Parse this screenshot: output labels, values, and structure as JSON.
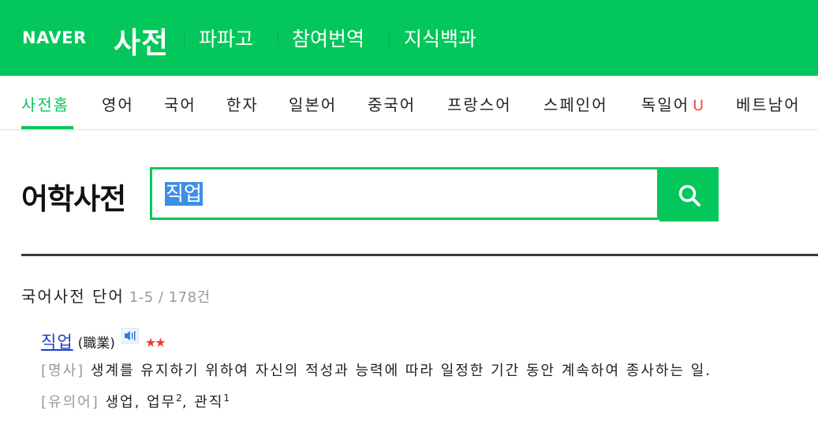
{
  "header": {
    "logo": "NAVER",
    "service": "사전",
    "links": [
      "파파고",
      "참여번역",
      "지식백과"
    ]
  },
  "tabs": [
    {
      "label": "사전홈",
      "active": true
    },
    {
      "label": "영어"
    },
    {
      "label": "국어"
    },
    {
      "label": "한자"
    },
    {
      "label": "일본어"
    },
    {
      "label": "중국어"
    },
    {
      "label": "프랑스어"
    },
    {
      "label": "스페인어"
    },
    {
      "label": "독일어",
      "badge": "U"
    },
    {
      "label": "베트남어"
    }
  ],
  "search": {
    "title": "어학사전",
    "value": "직업",
    "button_icon": "search-icon"
  },
  "results": {
    "section_title": "국어사전 단어",
    "count": "1-5 / 178건",
    "entries": [
      {
        "word": "직업",
        "hanja": "(職業)",
        "stars": "★★",
        "definition_tag": "[명사]",
        "definition": "생계를 유지하기 위하여 자신의 적성과 능력에 따라 일정한 기간 동안 계속하여 종사하는 일.",
        "synonym_tag": "[유의어]",
        "synonyms": [
          {
            "word": "생업",
            "sup": ""
          },
          {
            "word": "업무",
            "sup": "2"
          },
          {
            "word": "관직",
            "sup": "1"
          }
        ]
      }
    ]
  },
  "colors": {
    "brand": "#03c75a",
    "link": "#1a3fcc",
    "star": "#e8412a",
    "muted": "#999999"
  }
}
